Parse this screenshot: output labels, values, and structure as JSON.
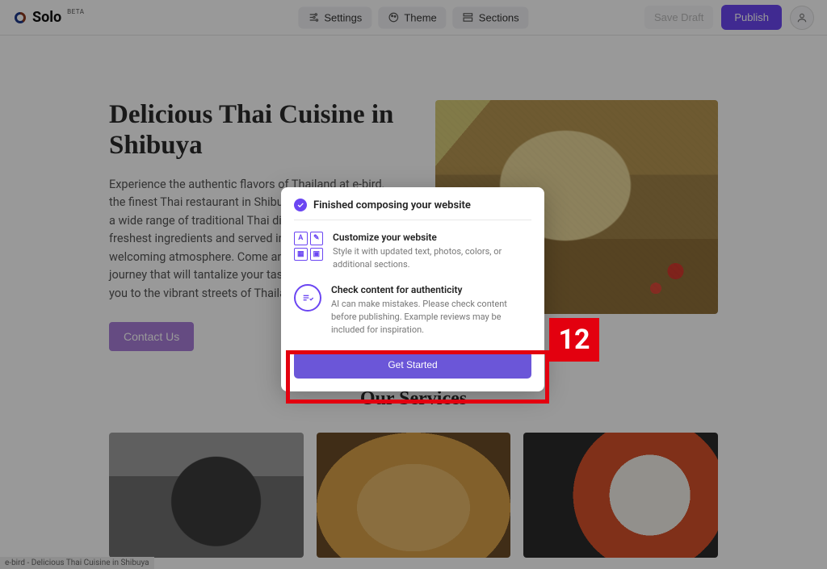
{
  "app": {
    "name": "Solo",
    "beta_label": "BETA"
  },
  "toolbar": {
    "settings": "Settings",
    "theme": "Theme",
    "sections": "Sections",
    "save_draft": "Save Draft",
    "publish": "Publish"
  },
  "hero": {
    "title": "Delicious Thai Cuisine in Shibuya",
    "description": "Experience the authentic flavors of Thailand at e-bird, the finest Thai restaurant in Shibuya. Our menu features a wide range of traditional Thai dishes, prepared with the freshest ingredients and served in a cozy and welcoming atmosphere. Come and indulge in a culinary journey that will tantalize your taste buds and transport you to the vibrant streets of Thailand.",
    "cta": "Contact Us"
  },
  "services": {
    "title": "Our Services"
  },
  "modal": {
    "title": "Finished composing your website",
    "item1": {
      "heading": "Customize your website",
      "body": "Style it with updated text, photos, colors, or additional sections."
    },
    "item2": {
      "heading": "Check content for authenticity",
      "body": "AI can make mistakes. Please check content before publishing. Example reviews may be included for inspiration."
    },
    "cta": "Get Started"
  },
  "callout": {
    "step_number": "12"
  },
  "status": {
    "text": "e-bird - Delicious Thai Cuisine in Shibuya"
  }
}
